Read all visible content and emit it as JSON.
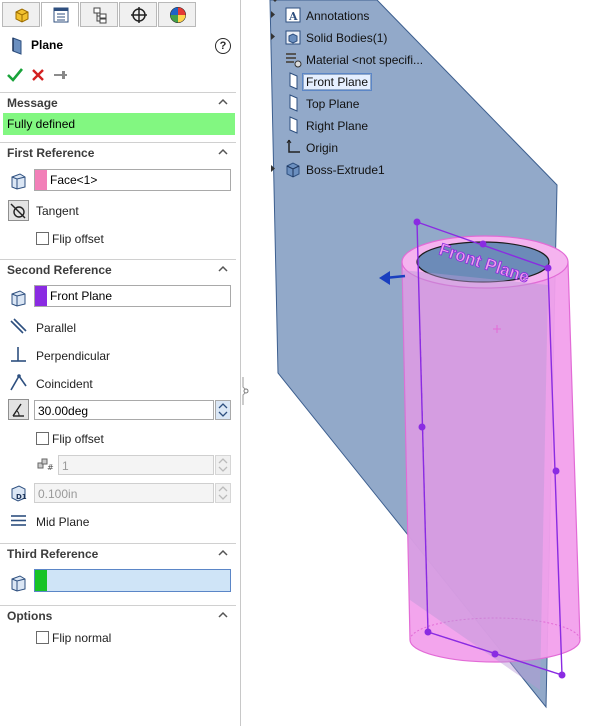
{
  "tabs": [
    {
      "name": "feature-manager"
    },
    {
      "name": "property-manager"
    },
    {
      "name": "configuration-manager"
    },
    {
      "name": "dimxpert-manager"
    },
    {
      "name": "display-manager"
    }
  ],
  "panel": {
    "title": "Plane",
    "help": "?"
  },
  "message": {
    "header": "Message",
    "text": "Fully defined",
    "color": "#82f781"
  },
  "first_reference": {
    "header": "First Reference",
    "selection": "Face<1>",
    "swatch_color": "#f27fb8",
    "options": [
      "Tangent"
    ],
    "flip_offset": "Flip offset"
  },
  "second_reference": {
    "header": "Second Reference",
    "selection": "Front Plane",
    "swatch_color": "#8a2be2",
    "options": [
      "Parallel",
      "Perpendicular",
      "Coincident"
    ],
    "angle_value": "30.00deg",
    "flip_offset": "Flip offset",
    "count_value": "1",
    "distance_value": "0.100in",
    "mid_plane": "Mid Plane"
  },
  "third_reference": {
    "header": "Third Reference",
    "swatch_color": "#17c327"
  },
  "options": {
    "header": "Options",
    "flip_normal": "Flip normal"
  },
  "tree": {
    "items": [
      {
        "label": "Annotations",
        "icon": "annotations-icon",
        "expandable": true
      },
      {
        "label": "Solid Bodies(1)",
        "icon": "solid-bodies-icon",
        "expandable": true
      },
      {
        "label": "Material <not specifi...",
        "icon": "material-icon",
        "expandable": false
      },
      {
        "label": "Front Plane",
        "icon": "plane-icon",
        "expandable": false,
        "selected": true
      },
      {
        "label": "Top Plane",
        "icon": "plane-icon",
        "expandable": false
      },
      {
        "label": "Right Plane",
        "icon": "plane-icon",
        "expandable": false
      },
      {
        "label": "Origin",
        "icon": "origin-icon",
        "expandable": false
      },
      {
        "label": "Boss-Extrude1",
        "icon": "extrude-icon",
        "expandable": true
      }
    ]
  },
  "viewport": {
    "plane_label": "Front Plane",
    "plane_color": "#7f9ac0",
    "cylinder_color": "#f2a0ec",
    "preview_color": "#8a2be2"
  }
}
